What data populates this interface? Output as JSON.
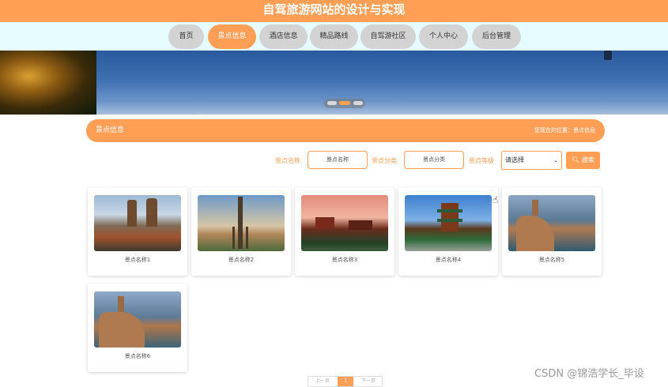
{
  "header": {
    "title": "自驾旅游网站的设计与实现"
  },
  "nav": {
    "items": [
      {
        "label": "首页"
      },
      {
        "label": "景点信息"
      },
      {
        "label": "酒店信息"
      },
      {
        "label": "精品路线"
      },
      {
        "label": "自驾游社区"
      },
      {
        "label": "个人中心"
      },
      {
        "label": "后台管理"
      }
    ],
    "active_index": 1
  },
  "banner": {
    "slide_count": 3,
    "active_slide": 2
  },
  "section": {
    "title": "景点信息",
    "breadcrumb": "您现在的位置：景点信息"
  },
  "search": {
    "name_label": "景点名称",
    "name_placeholder": "景点名称",
    "category_label": "景点分类",
    "category_placeholder": "景点分类",
    "level_label": "景点等级",
    "level_selected": "请选择",
    "button_label": "搜索"
  },
  "cards": [
    {
      "name": "景点名称1"
    },
    {
      "name": "景点名称2"
    },
    {
      "name": "景点名称3"
    },
    {
      "name": "景点名称4"
    },
    {
      "name": "景点名称5"
    },
    {
      "name": "景点名称6"
    }
  ],
  "pagination": {
    "prev": "上一页",
    "current": "1",
    "next": "下一页"
  },
  "watermark": "CSDN @锦浩学长_毕设",
  "colors": {
    "accent": "#ff9f55",
    "nav_bg": "#e6fbfd",
    "nav_item": "#d3d3d3"
  }
}
